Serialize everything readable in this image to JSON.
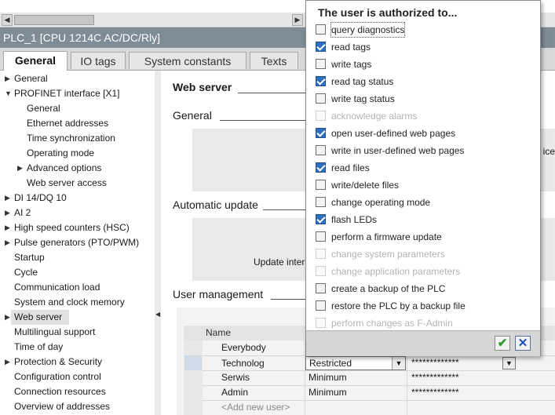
{
  "window": {
    "device_title": "PLC_1 [CPU 1214C AC/DC/Rly]"
  },
  "tabs": [
    {
      "label": "General",
      "active": true
    },
    {
      "label": "IO tags",
      "active": false
    },
    {
      "label": "System constants",
      "active": false
    },
    {
      "label": "Texts",
      "active": false
    }
  ],
  "tree": [
    {
      "label": "General",
      "level": 0,
      "expander": "collapsed"
    },
    {
      "label": "PROFINET interface [X1]",
      "level": 0,
      "expander": "expanded"
    },
    {
      "label": "General",
      "level": 1,
      "expander": "none"
    },
    {
      "label": "Ethernet addresses",
      "level": 1,
      "expander": "none"
    },
    {
      "label": "Time synchronization",
      "level": 1,
      "expander": "none"
    },
    {
      "label": "Operating mode",
      "level": 1,
      "expander": "none"
    },
    {
      "label": "Advanced options",
      "level": 1,
      "expander": "collapsed"
    },
    {
      "label": "Web server access",
      "level": 1,
      "expander": "none"
    },
    {
      "label": "DI 14/DQ 10",
      "level": 0,
      "expander": "collapsed"
    },
    {
      "label": "AI 2",
      "level": 0,
      "expander": "collapsed"
    },
    {
      "label": "High speed counters (HSC)",
      "level": 0,
      "expander": "collapsed"
    },
    {
      "label": "Pulse generators (PTO/PWM)",
      "level": 0,
      "expander": "collapsed"
    },
    {
      "label": "Startup",
      "level": 0,
      "expander": "none"
    },
    {
      "label": "Cycle",
      "level": 0,
      "expander": "none"
    },
    {
      "label": "Communication load",
      "level": 0,
      "expander": "none"
    },
    {
      "label": "System and clock memory",
      "level": 0,
      "expander": "none"
    },
    {
      "label": "Web server",
      "level": 0,
      "expander": "collapsed",
      "selected": true
    },
    {
      "label": "Multilingual support",
      "level": 0,
      "expander": "none"
    },
    {
      "label": "Time of day",
      "level": 0,
      "expander": "none"
    },
    {
      "label": "Protection & Security",
      "level": 0,
      "expander": "collapsed"
    },
    {
      "label": "Configuration control",
      "level": 0,
      "expander": "none"
    },
    {
      "label": "Connection resources",
      "level": 0,
      "expander": "none"
    },
    {
      "label": "Overview of addresses",
      "level": 0,
      "expander": "none"
    }
  ],
  "content": {
    "web_server_heading": "Web server",
    "general_heading": "General",
    "auto_update_heading": "Automatic update",
    "update_interval_partial": "Update inter",
    "user_mgmt_heading": "User management",
    "device_partial": "ice"
  },
  "users_table": {
    "header_name": "Name",
    "rows": [
      {
        "name": "Everybody",
        "access": "",
        "password": ""
      },
      {
        "name": "Technolog",
        "access": "Restricted",
        "password": "*************"
      },
      {
        "name": "Serwis",
        "access": "Minimum",
        "password": "*************"
      },
      {
        "name": "Admin",
        "access": "Minimum",
        "password": "*************"
      }
    ],
    "add_new_user": "<Add new user>"
  },
  "popup": {
    "title": "The user is authorized to...",
    "permissions": [
      {
        "label": "query diagnostics",
        "checked": false,
        "enabled": true,
        "focused": true
      },
      {
        "label": "read tags",
        "checked": true,
        "enabled": true
      },
      {
        "label": "write tags",
        "checked": false,
        "enabled": true
      },
      {
        "label": "read tag status",
        "checked": true,
        "enabled": true
      },
      {
        "label": "write tag status",
        "checked": false,
        "enabled": true
      },
      {
        "label": "acknowledge alarms",
        "checked": false,
        "enabled": false
      },
      {
        "label": "open user-defined web pages",
        "checked": true,
        "enabled": true
      },
      {
        "label": "write in user-defined web pages",
        "checked": false,
        "enabled": true
      },
      {
        "label": "read files",
        "checked": true,
        "enabled": true
      },
      {
        "label": "write/delete files",
        "checked": false,
        "enabled": true
      },
      {
        "label": "change operating mode",
        "checked": false,
        "enabled": true
      },
      {
        "label": "flash LEDs",
        "checked": true,
        "enabled": true
      },
      {
        "label": "perform a firmware update",
        "checked": false,
        "enabled": true
      },
      {
        "label": "change system parameters",
        "checked": false,
        "enabled": false
      },
      {
        "label": "change application parameters",
        "checked": false,
        "enabled": false
      },
      {
        "label": "create a backup of the PLC",
        "checked": false,
        "enabled": true
      },
      {
        "label": "restore the PLC by a backup file",
        "checked": false,
        "enabled": true
      },
      {
        "label": "perform changes as F-Admin",
        "checked": false,
        "enabled": false
      }
    ],
    "confirm_icon": "checkmark-icon",
    "cancel_icon": "close-icon"
  },
  "colors": {
    "title_bar": "#7e8c96",
    "checkbox_checked": "#2f6fbf",
    "confirm_green": "#2e9c2e",
    "cancel_blue": "#1e4fb8"
  }
}
